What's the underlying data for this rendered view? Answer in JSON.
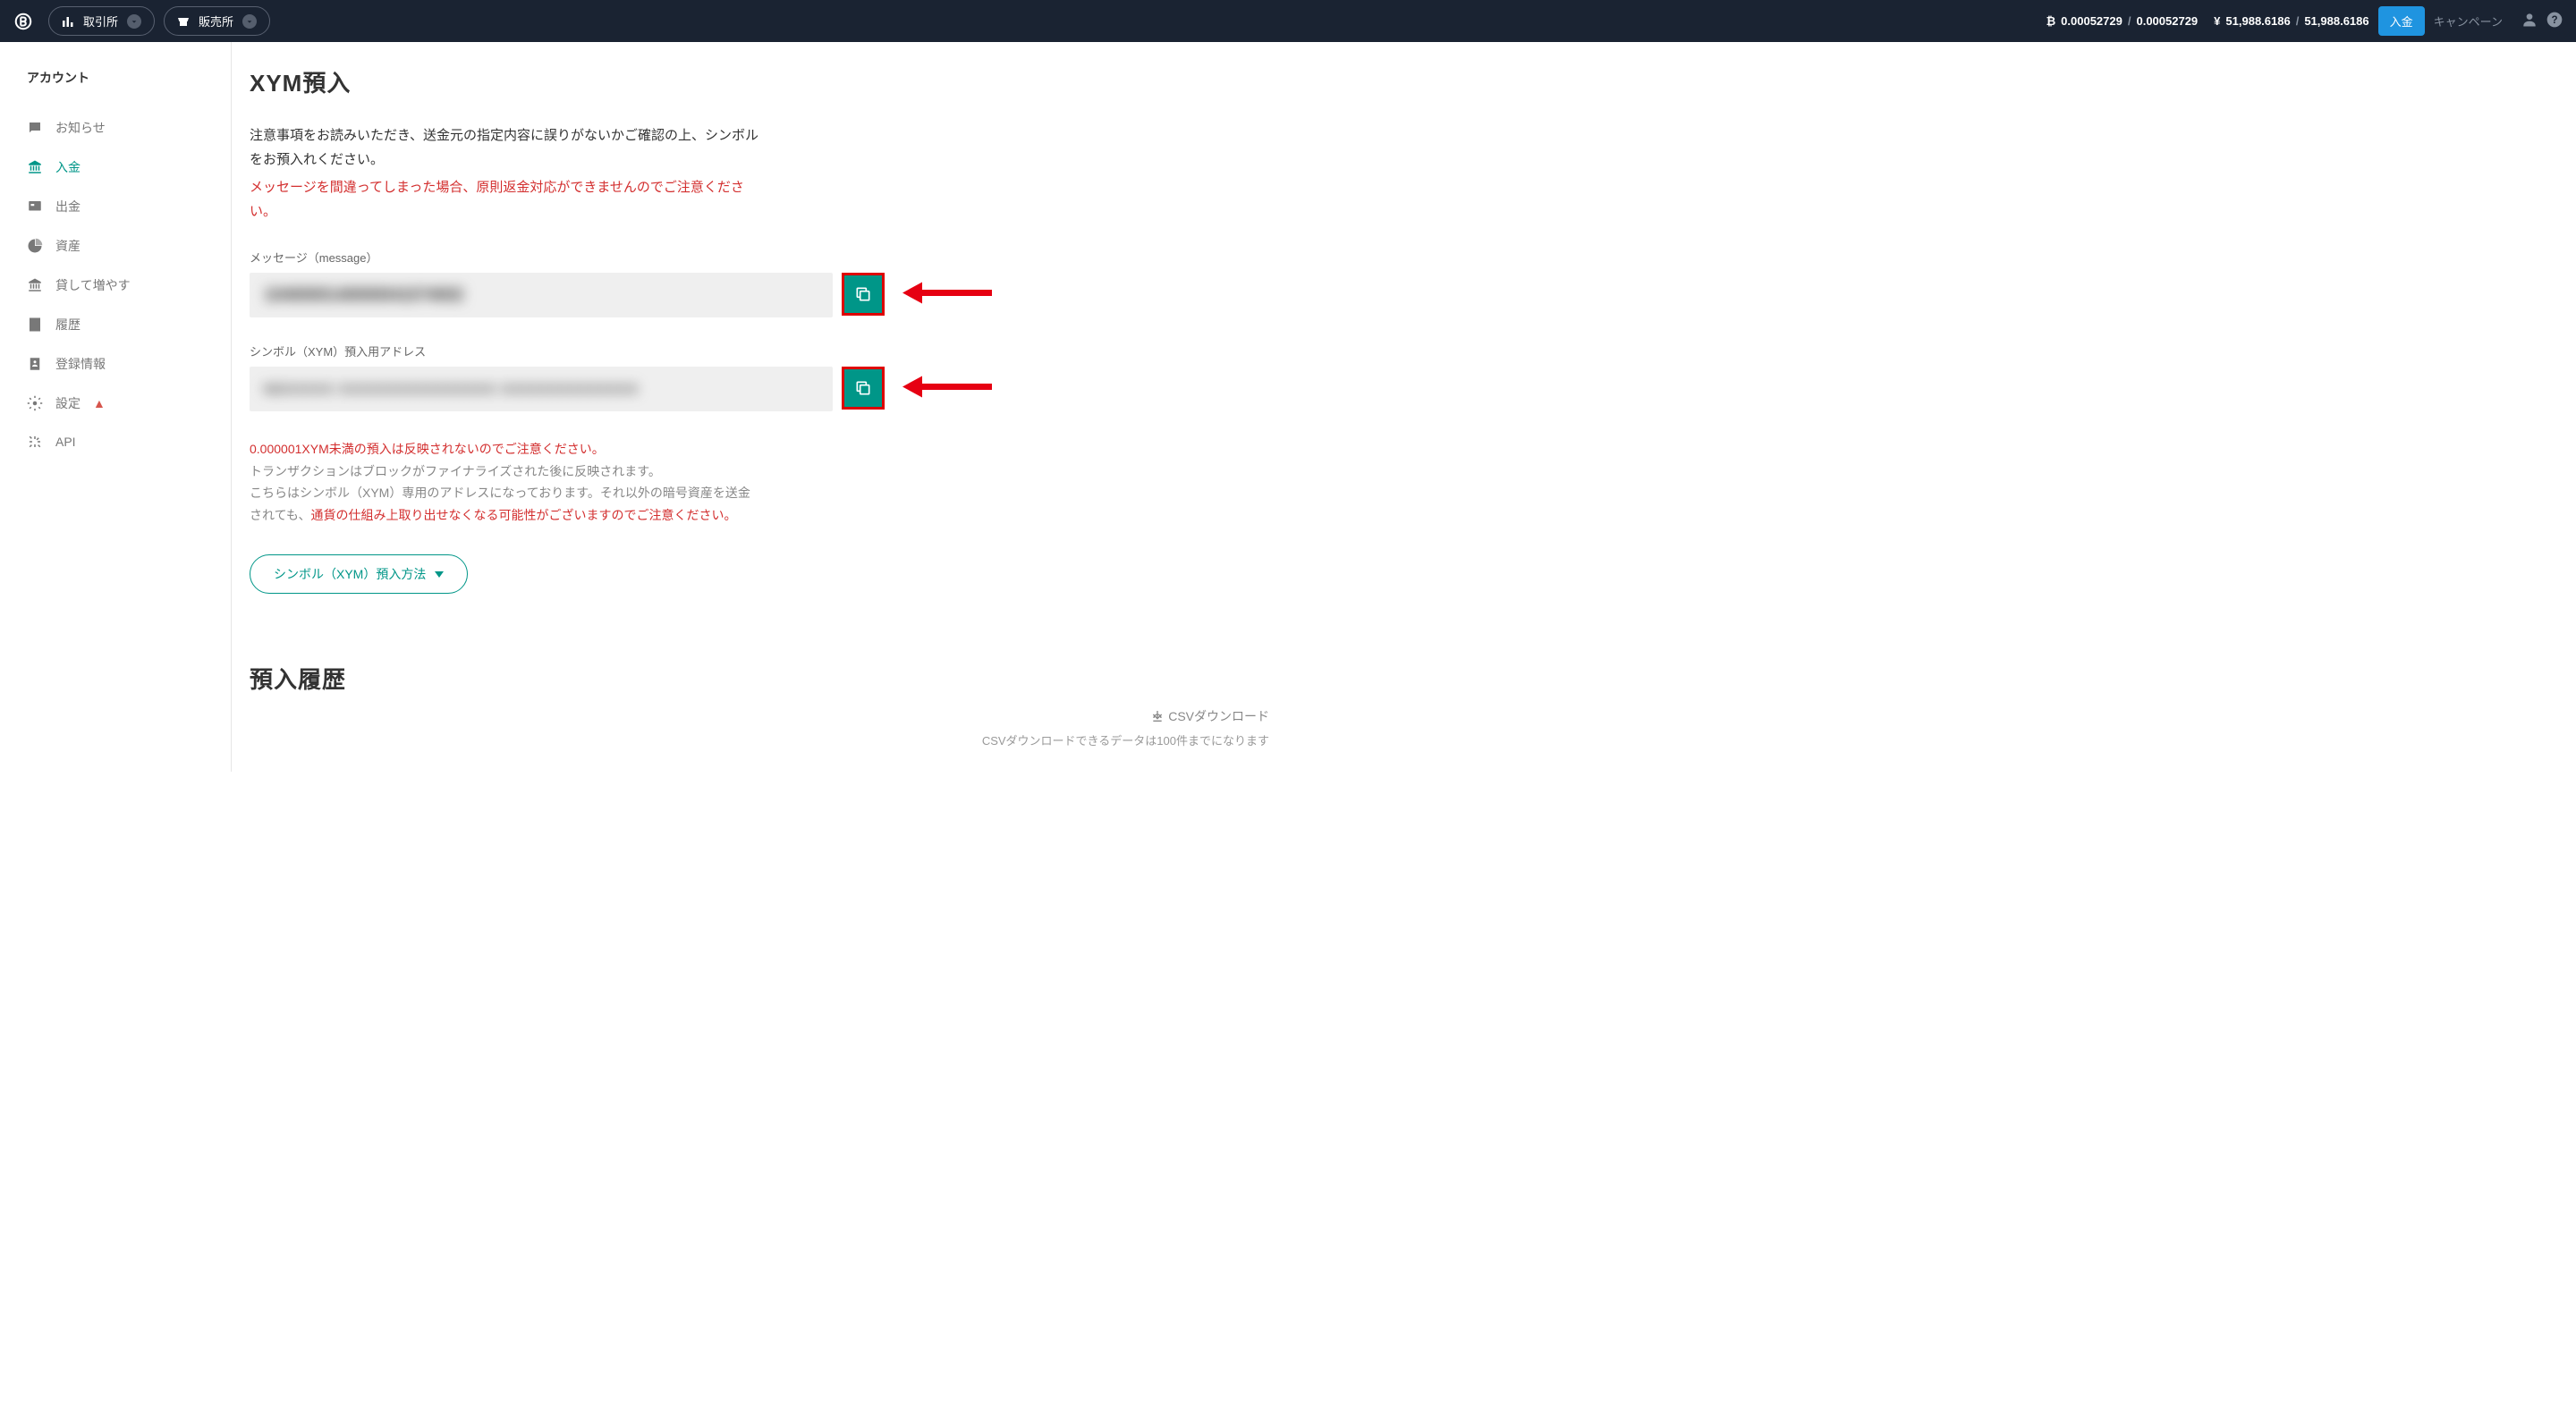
{
  "header": {
    "dropdown1": "取引所",
    "dropdown2": "販売所",
    "btc_label": "₿",
    "btc_bid": "0.00052729",
    "btc_ask": "0.00052729",
    "jpy_label": "¥",
    "jpy_bid": "51,988.6186",
    "jpy_ask": "51,988.6186",
    "deposit": "入金",
    "campaign": "キャンペーン"
  },
  "sidebar": {
    "title": "アカウント",
    "items": [
      {
        "label": "お知らせ"
      },
      {
        "label": "入金"
      },
      {
        "label": "出金"
      },
      {
        "label": "資産"
      },
      {
        "label": "貸して増やす"
      },
      {
        "label": "履歴"
      },
      {
        "label": "登録情報"
      },
      {
        "label": "設定"
      },
      {
        "label": "API"
      }
    ]
  },
  "main": {
    "title": "XYM預入",
    "instr1": "注意事項をお読みいただき、送金元の指定内容に誤りがないかご確認の上、シンボルをお預入れください。",
    "instr2": "メッセージを間違ってしまった場合、原則返金対応ができませんのでご注意ください。",
    "msg_label": "メッセージ（message）",
    "msg_value": "1040000140000041074002",
    "addr_label": "シンボル（XYM）預入用アドレス",
    "addr_value": "NDXXXXX XXXXXXXXXXXXXXXX XXXXXXXXXXXXXX",
    "note1": "0.000001XYM未満の預入は反映されないのでご注意ください。",
    "note2": "トランザクションはブロックがファイナライズされた後に反映されます。",
    "note3a": "こちらはシンボル（XYM）専用のアドレスになっております。それ以外の暗号資産を送金されても、",
    "note3b": "通貨の仕組み上取り出せなくなる可能性がございますのでご注意ください。",
    "pill": "シンボル（XYM）預入方法",
    "history": "預入履歴",
    "csv_link": "CSVダウンロード",
    "csv_note": "CSVダウンロードできるデータは100件までになります"
  }
}
